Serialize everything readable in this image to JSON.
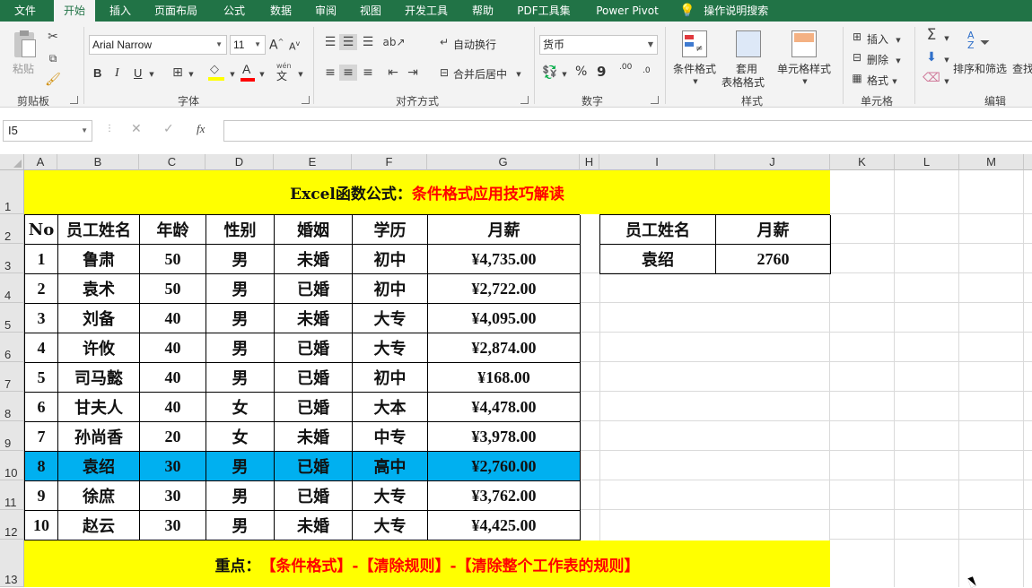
{
  "tabs": [
    "文件",
    "开始",
    "插入",
    "页面布局",
    "公式",
    "数据",
    "审阅",
    "视图",
    "开发工具",
    "帮助",
    "PDF工具集",
    "Power Pivot"
  ],
  "active_tab": "开始",
  "tell_me": "操作说明搜索",
  "ribbon": {
    "clipboard": {
      "paste": "粘贴",
      "label": "剪贴板"
    },
    "font": {
      "name": "Arial Narrow",
      "size": "11",
      "bold": "B",
      "italic": "I",
      "underline": "U",
      "wen": "wén",
      "wen_char": "文",
      "label": "字体",
      "grow": "A",
      "shrink": "A"
    },
    "alignment": {
      "wrap": "自动换行",
      "merge": "合并后居中",
      "label": "对齐方式"
    },
    "number": {
      "format": "货币",
      "percent": "%",
      "comma": "9",
      "inc": ".00",
      "label": "数字"
    },
    "styles": {
      "conditional": "条件格式",
      "table_1": "套用",
      "table_2": "表格格式",
      "cell_styles": "单元格样式",
      "label": "样式"
    },
    "cells": {
      "insert": "插入",
      "delete": "删除",
      "format": "格式",
      "label": "单元格"
    },
    "editing": {
      "sort": "排序和筛选",
      "find": "查找",
      "label": "编辑"
    }
  },
  "formula_bar": {
    "name_box": "I5",
    "fx": "fx",
    "cancel": "✕",
    "enter": "✓"
  },
  "columns": [
    "A",
    "B",
    "C",
    "D",
    "E",
    "F",
    "G",
    "H",
    "I",
    "J",
    "K",
    "L",
    "M"
  ],
  "rows": [
    "1",
    "2",
    "3",
    "4",
    "5",
    "6",
    "7",
    "8",
    "9",
    "10",
    "11",
    "12",
    "13"
  ],
  "sheet": {
    "title_black": "Excel函数公式：",
    "title_red": "条件格式应用技巧解读",
    "headers": [
      "No",
      "员工姓名",
      "年龄",
      "性别",
      "婚姻",
      "学历",
      "月薪"
    ],
    "data": [
      [
        "1",
        "鲁肃",
        "50",
        "男",
        "未婚",
        "初中",
        "¥4,735.00"
      ],
      [
        "2",
        "袁术",
        "50",
        "男",
        "已婚",
        "初中",
        "¥2,722.00"
      ],
      [
        "3",
        "刘备",
        "40",
        "男",
        "未婚",
        "大专",
        "¥4,095.00"
      ],
      [
        "4",
        "许攸",
        "40",
        "男",
        "已婚",
        "大专",
        "¥2,874.00"
      ],
      [
        "5",
        "司马懿",
        "40",
        "男",
        "已婚",
        "初中",
        "¥168.00"
      ],
      [
        "6",
        "甘夫人",
        "40",
        "女",
        "已婚",
        "大本",
        "¥4,478.00"
      ],
      [
        "7",
        "孙尚香",
        "20",
        "女",
        "未婚",
        "中专",
        "¥3,978.00"
      ],
      [
        "8",
        "袁绍",
        "30",
        "男",
        "已婚",
        "高中",
        "¥2,760.00"
      ],
      [
        "9",
        "徐庶",
        "30",
        "男",
        "已婚",
        "大专",
        "¥3,762.00"
      ],
      [
        "10",
        "赵云",
        "30",
        "男",
        "未婚",
        "大专",
        "¥4,425.00"
      ]
    ],
    "highlight_row": 8,
    "highlight_color": "#00b0f0",
    "lookup_headers": [
      "员工姓名",
      "月薪"
    ],
    "lookup_values": [
      "袁绍",
      "2760"
    ],
    "footer_black": "重点：",
    "footer_red": "【条件格式】-【清除规则】-【清除整个工作表的规则】"
  },
  "colors": {
    "accent": "#217346",
    "yellow": "#ffff00",
    "red": "#ff0000"
  }
}
